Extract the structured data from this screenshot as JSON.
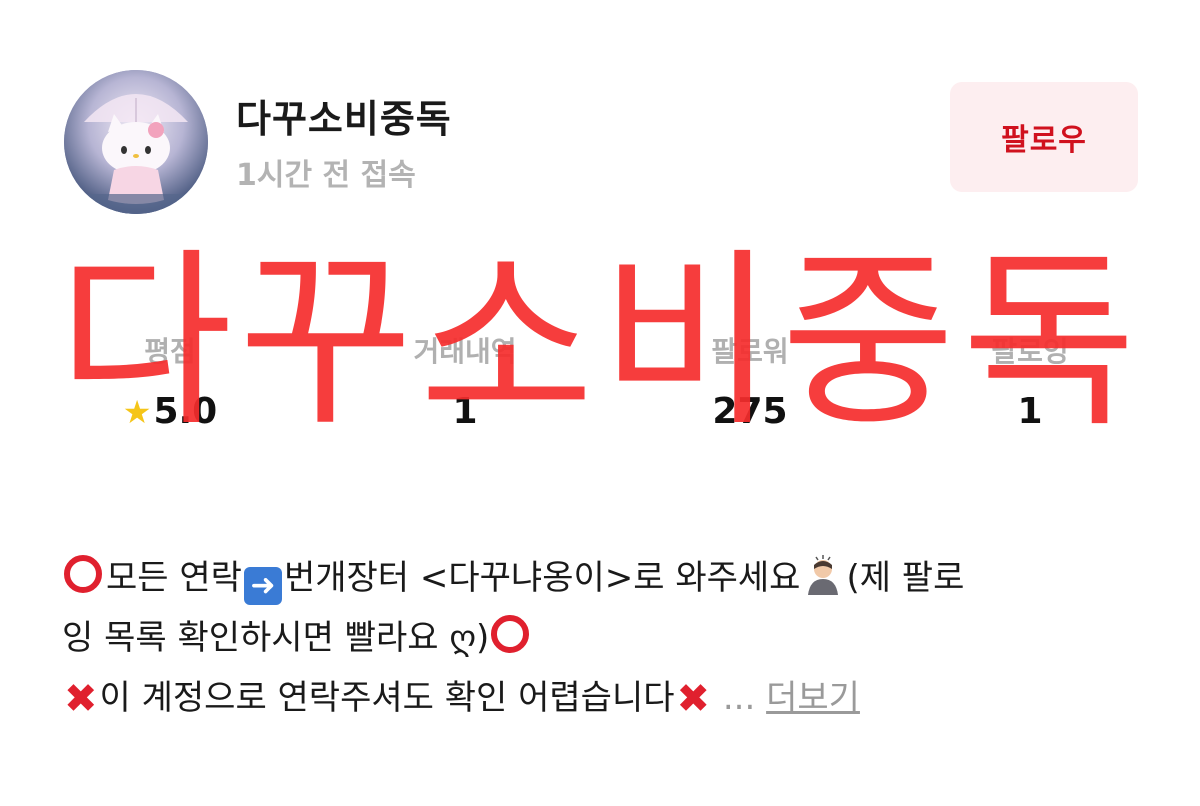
{
  "profile": {
    "username": "다꾸소비중독",
    "last_active": "1시간 전 접속",
    "follow_label": "팔로우"
  },
  "watermark": "다꾸소비중독",
  "stats": [
    {
      "label": "평점",
      "value": "5.0",
      "icon": "star-icon"
    },
    {
      "label": "거래내역",
      "value": "1"
    },
    {
      "label": "팔로워",
      "value": "275"
    },
    {
      "label": "팔로잉",
      "value": "1"
    }
  ],
  "bio": {
    "line1_a": "모든 연락",
    "line1_b": "번개장터 <다꾸냐옹이>로 와주세요",
    "line1_c": "(제 팔로",
    "line2_a": "잉 목록 확인하시면 빨라요 ",
    "line2_heart": "ღ",
    "line2_b": ")",
    "line3_a": "이 계정으로 연락주셔도 확인 어렵습니다",
    "ellipsis": "...",
    "more_label": "더보기"
  },
  "colors": {
    "accent_red": "#d0111e",
    "follow_bg": "#fdeef0",
    "watermark": "#f52d2d",
    "muted": "#b3b3b3"
  }
}
